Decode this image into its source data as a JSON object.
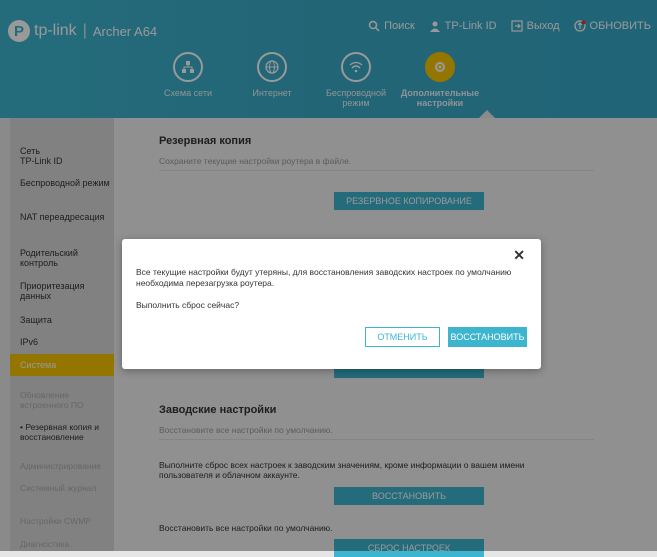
{
  "header": {
    "brand": "tp-link",
    "model": "Archer A64",
    "links": [
      {
        "label": "Поиск",
        "icon": "search-icon"
      },
      {
        "label": "TP-Link ID",
        "icon": "user-icon"
      },
      {
        "label": "Выход",
        "icon": "logout-icon"
      },
      {
        "label": "ОБНОВИТЬ",
        "icon": "update-icon"
      }
    ],
    "nav": [
      {
        "label": "Схема сети",
        "icon": "network-map-icon"
      },
      {
        "label": "Интернет",
        "icon": "globe-icon"
      },
      {
        "label": "Беспроводной режим",
        "icon": "wifi-icon"
      },
      {
        "label": "Дополнительные настройки",
        "icon": "gear-icon"
      }
    ]
  },
  "sidebar": {
    "items": [
      "Сеть",
      "TP-Link ID",
      "Беспроводной режим",
      "NAT переадресация",
      "Родительский контроль",
      "Приоритезация данных",
      "Защита",
      "IPv6",
      "Система"
    ],
    "subitems": [
      "Обновление встроенного ПО",
      "Резервная копия и восстановление",
      "Администрирование",
      "Системный журнал",
      "Настройки CWMP",
      "Диагностика"
    ]
  },
  "main": {
    "backup_title": "Резервная копия",
    "backup_desc": "Сохраните текущие настройки роутера в файле.",
    "backup_button": "РЕЗЕРВНОЕ КОПИРОВАНИЕ",
    "factory_title": "Заводские настройки",
    "factory_desc": "Восстановите все настройки по умолчанию.",
    "factory_text1": "Выполните сброс всех настроек к заводским значениям, кроме информации о вашем имени пользователя и облачном аккаунте.",
    "factory_button1": "ВОССТАНОВИТЬ",
    "factory_text2": "Восстановить все настройки по умолчанию.",
    "factory_button2": "СБРОС НАСТРОЕК"
  },
  "modal": {
    "close": "✕",
    "message": "Все текущие настройки будут утеряны, для восстановления заводских настроек по умолчанию необходима перезагрузка роутера.",
    "question": "Выполнить сброс сейчас?",
    "cancel": "ОТМЕНИТЬ",
    "restore": "ВОССТАНОВИТЬ"
  },
  "colors": {
    "accent": "#3db5cf",
    "active": "#f6c300"
  }
}
